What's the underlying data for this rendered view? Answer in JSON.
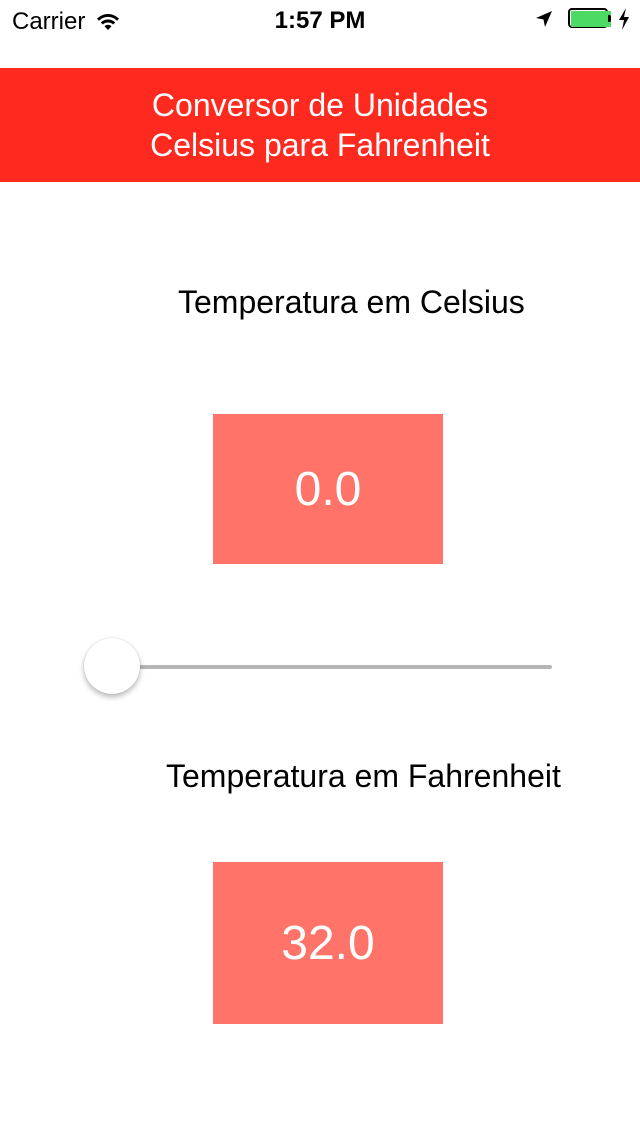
{
  "status_bar": {
    "carrier": "Carrier",
    "time": "1:57 PM",
    "battery_color": "#4cd964",
    "icons": [
      "wifi-icon",
      "location-arrow-icon",
      "battery-icon",
      "charging-bolt-icon"
    ]
  },
  "header": {
    "line1": "Conversor de Unidades",
    "line2": "Celsius para Fahrenheit",
    "background": "#ff2a1f"
  },
  "celsius": {
    "label": "Temperatura em Celsius",
    "value": "0.0"
  },
  "slider": {
    "min": -100,
    "max": 100,
    "value": 0,
    "fraction": 0
  },
  "fahrenheit": {
    "label": "Temperatura em Fahrenheit",
    "value": "32.0"
  },
  "colors": {
    "value_box": "#ff7369",
    "text_on_box": "#ffffff"
  }
}
